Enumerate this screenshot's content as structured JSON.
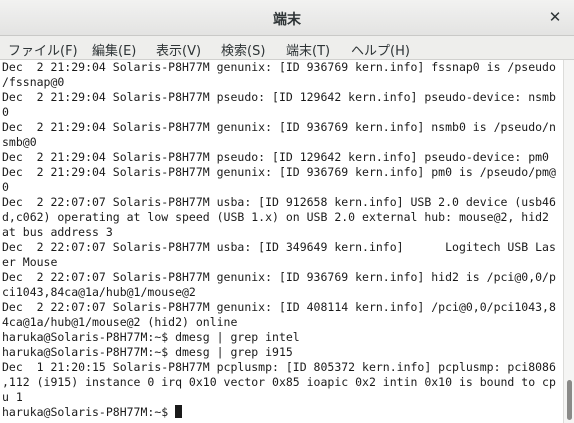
{
  "window": {
    "title": "端末"
  },
  "menu": [
    "ファイル(F)",
    "編集(E)",
    "表示(V)",
    "検索(S)",
    "端末(T)",
    "ヘルプ(H)"
  ],
  "terminal_lines": [
    "Dec  2 21:29:04 Solaris-P8H77M genunix: [ID 936769 kern.info] fssnap0 is /pseudo",
    "/fssnap@0",
    "Dec  2 21:29:04 Solaris-P8H77M pseudo: [ID 129642 kern.info] pseudo-device: nsmb",
    "0",
    "Dec  2 21:29:04 Solaris-P8H77M genunix: [ID 936769 kern.info] nsmb0 is /pseudo/n",
    "smb@0",
    "Dec  2 21:29:04 Solaris-P8H77M pseudo: [ID 129642 kern.info] pseudo-device: pm0",
    "Dec  2 21:29:04 Solaris-P8H77M genunix: [ID 936769 kern.info] pm0 is /pseudo/pm@",
    "0",
    "Dec  2 22:07:07 Solaris-P8H77M usba: [ID 912658 kern.info] USB 2.0 device (usb46",
    "d,c062) operating at low speed (USB 1.x) on USB 2.0 external hub: mouse@2, hid2",
    "at bus address 3",
    "Dec  2 22:07:07 Solaris-P8H77M usba: [ID 349649 kern.info]      Logitech USB Las",
    "er Mouse",
    "Dec  2 22:07:07 Solaris-P8H77M genunix: [ID 936769 kern.info] hid2 is /pci@0,0/p",
    "ci1043,84ca@1a/hub@1/mouse@2",
    "Dec  2 22:07:07 Solaris-P8H77M genunix: [ID 408114 kern.info] /pci@0,0/pci1043,8",
    "4ca@1a/hub@1/mouse@2 (hid2) online",
    "haruka@Solaris-P8H77M:~$ dmesg | grep intel",
    "haruka@Solaris-P8H77M:~$ dmesg | grep i915",
    "Dec  1 21:20:15 Solaris-P8H77M pcplusmp: [ID 805372 kern.info] pcplusmp: pci8086",
    ",112 (i915) instance 0 irq 0x10 vector 0x85 ioapic 0x2 intin 0x10 is bound to cp",
    "u 1"
  ],
  "prompt": "haruka@Solaris-P8H77M:~$ "
}
